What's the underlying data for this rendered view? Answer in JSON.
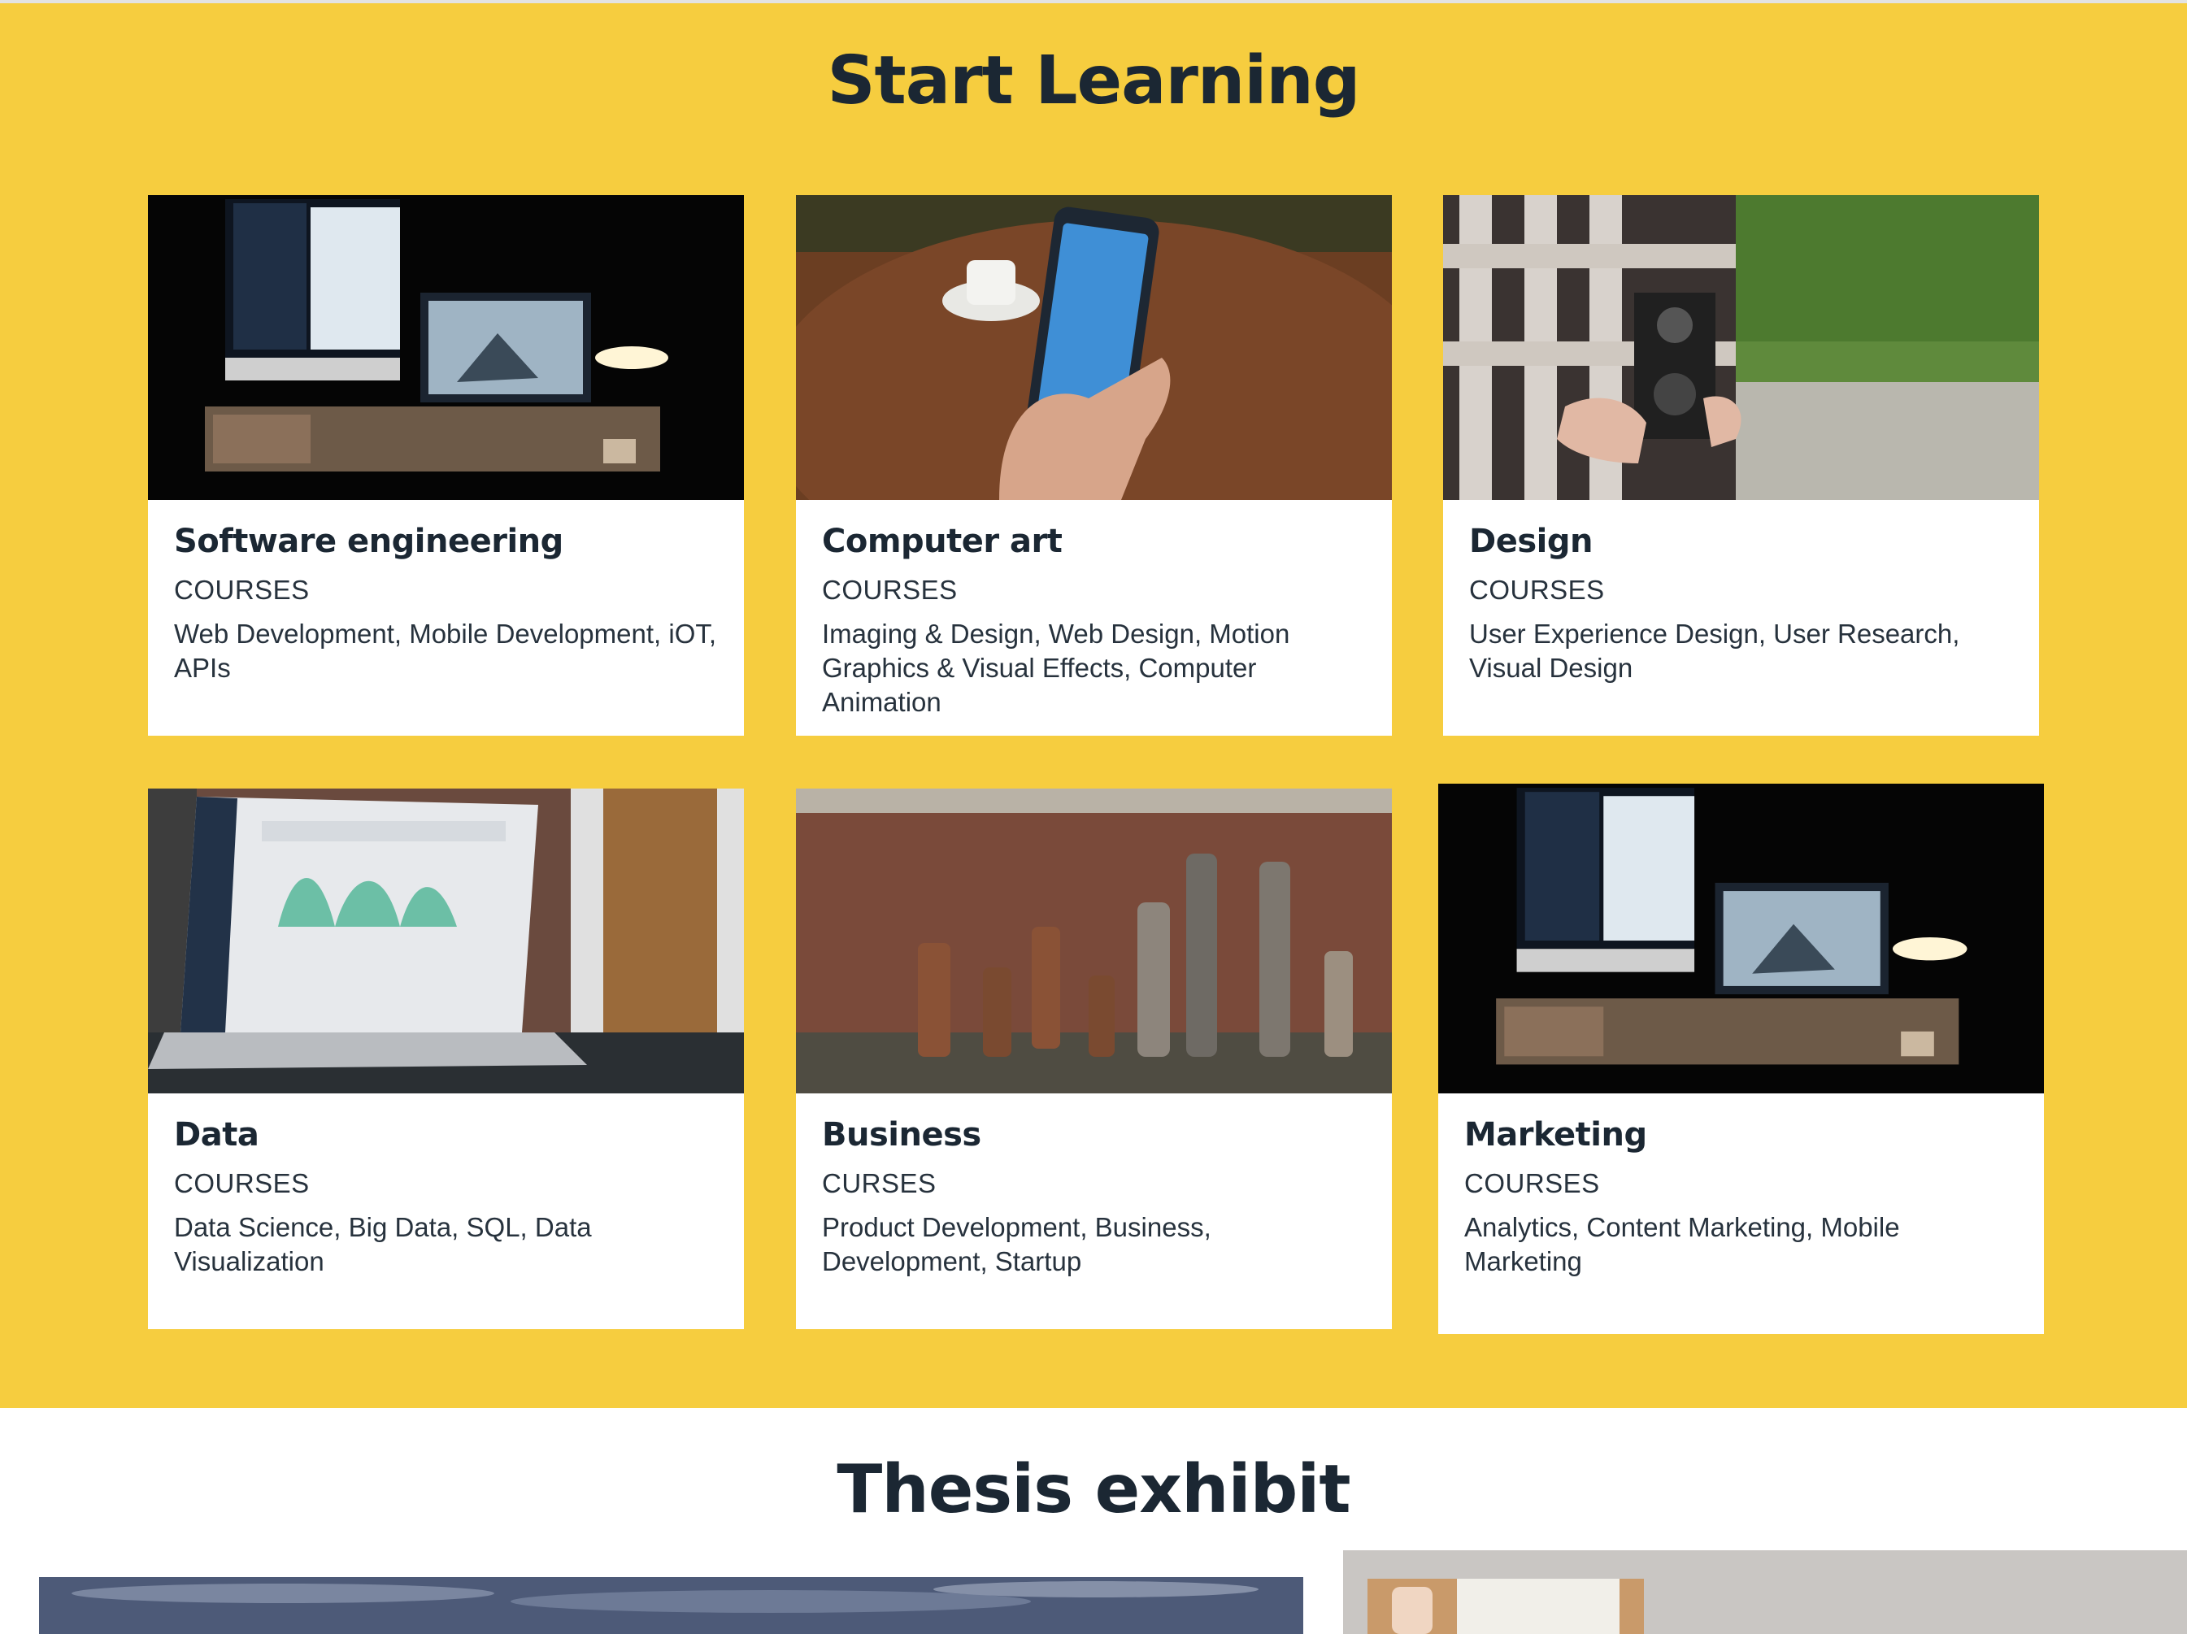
{
  "learn": {
    "title": "Start Learning",
    "background": "#f6cd3f",
    "cards": [
      {
        "title": "Software engineering",
        "label": "COURSES",
        "desc": "Web Development, Mobile Development, iOT, APIs",
        "image": "desk-computer-photo"
      },
      {
        "title": "Computer art",
        "label": "COURSES",
        "desc": "Imaging & Design, Web Design, Motion Graphics & Visual Effects, Computer Animation",
        "image": "phone-in-hand-photo"
      },
      {
        "title": "Design",
        "label": "COURSES",
        "desc": "User Experience Design, User Research, Visual Design",
        "image": "vintage-camera-photo"
      },
      {
        "title": "Data",
        "label": "COURSES",
        "desc": "Data Science, Big Data, SQL, Data Visualization",
        "image": "laptop-dashboard-photo"
      },
      {
        "title": "Business",
        "label": "CURSES",
        "desc": "Product Development, Business, Development, Startup",
        "image": "chess-pieces-photo"
      },
      {
        "title": "Marketing",
        "label": "COURSES",
        "desc": "Analytics, Content Marketing, Mobile Marketing",
        "image": "desk-computer-photo"
      }
    ]
  },
  "thesis": {
    "title": "Thesis exhibit"
  },
  "colors": {
    "accent": "#f6cd3f",
    "text": "#1b2733",
    "card": "#ffffff"
  }
}
